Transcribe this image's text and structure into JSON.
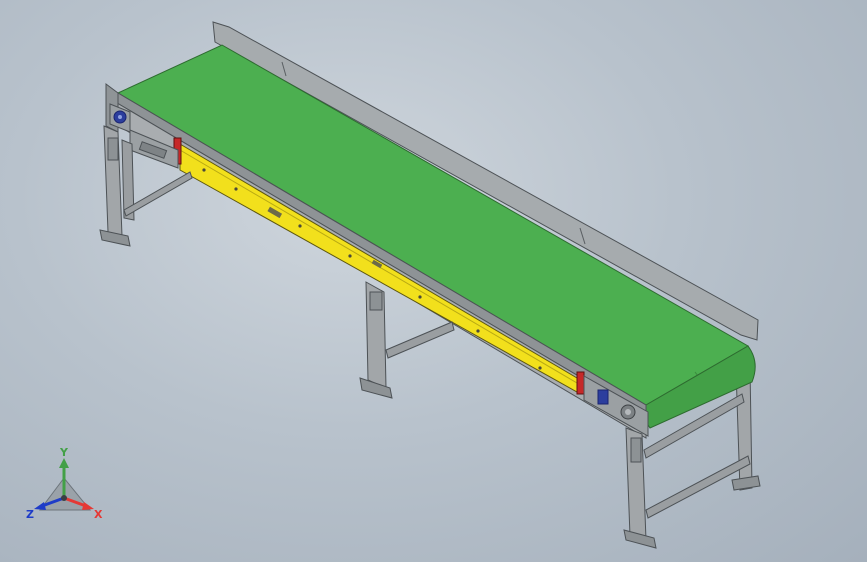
{
  "viewport": {
    "model": "belt-conveyor-assembly",
    "colors": {
      "background": "#b8c2cc",
      "belt": "#4caf50",
      "belt_edge": "#2e7d32",
      "frame": "#9a9ea1",
      "guard": "#f2e01c",
      "end_cap": "#c62828",
      "motor": "#2c3e9e"
    }
  },
  "triad": {
    "y_label": "Y",
    "x_label": "X",
    "z_label": "Z",
    "colors": {
      "x": "#e53935",
      "y": "#43a047",
      "z": "#1e3cc8"
    }
  }
}
